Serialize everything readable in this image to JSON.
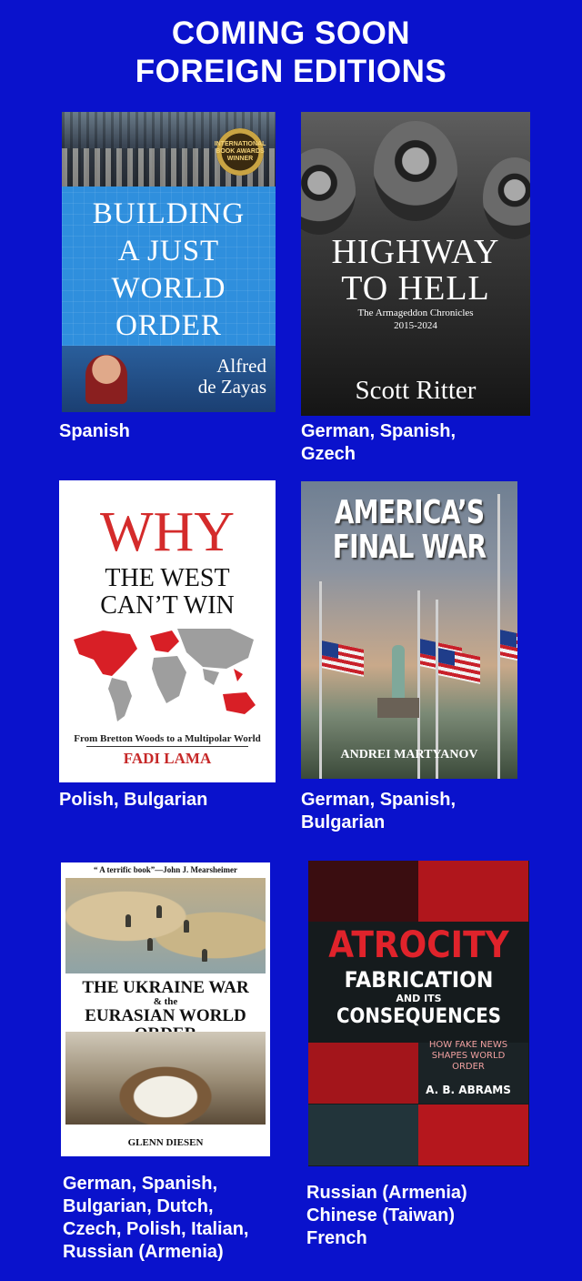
{
  "header": {
    "line1": "COMING SOON",
    "line2": "FOREIGN EDITIONS"
  },
  "books": [
    {
      "title": "BUILDING\nA JUST\nWORLD\nORDER",
      "author": "Alfred\nde Zayas",
      "badge": "INTERNATIONAL BOOK AWARDS WINNER",
      "languages": "Spanish"
    },
    {
      "title": "HIGHWAY\nTO HELL",
      "subtitle": "The Armageddon Chronicles\n2015-2024",
      "author": "Scott Ritter",
      "languages": "German, Spanish,\nGzech"
    },
    {
      "title_top": "WHY",
      "title_rest": "THE WEST\nCAN’T WIN",
      "tagline": "From Bretton Woods to a Multipolar World",
      "author": "FADI LAMA",
      "languages": "Polish, Bulgarian"
    },
    {
      "title": "AMERICA’S\nFINAL WAR",
      "author": "ANDREI MARTYANOV",
      "languages": "German, Spanish,\nBulgarian"
    },
    {
      "quote": "“ A terrific book”—John J. Mearsheimer",
      "title_line1": "THE UKRAINE WAR",
      "title_amp": "& the",
      "title_line2": "EURASIAN WORLD ORDER",
      "author": "GLENN DIESEN",
      "languages": "German, Spanish,\nBulgarian, Dutch,\nCzech, Polish, Italian,\nRussian (Armenia)"
    },
    {
      "title_line1": "ATROCITY",
      "title_line2": "FABRICATION",
      "title_line3": "AND ITS",
      "title_line4": "CONSEQUENCES",
      "subtitle": "HOW FAKE NEWS\nSHAPES WORLD ORDER",
      "author": "A. B. ABRAMS",
      "languages": "Russian (Armenia)\nChinese (Taiwan)\nFrench"
    }
  ],
  "colors": {
    "background": "#0a12cc",
    "text": "#ffffff",
    "accent_red": "#d42b2b"
  }
}
